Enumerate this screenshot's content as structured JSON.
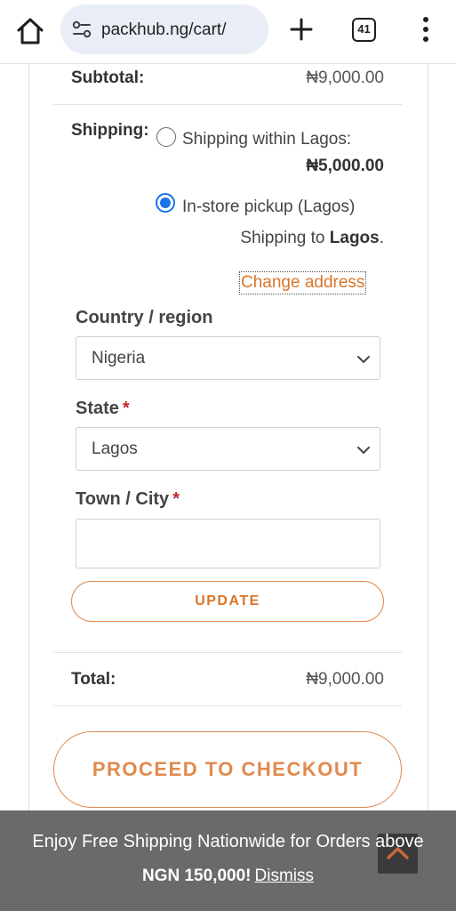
{
  "browser": {
    "url": "packhub.ng/cart/",
    "tab_count": "41"
  },
  "cart_totals": {
    "subtotal_label": "Subtotal:",
    "subtotal_value": "₦9,000.00",
    "shipping_label": "Shipping:",
    "options": [
      {
        "label": "Shipping within Lagos:",
        "price": "₦5,000.00",
        "selected": false
      },
      {
        "label": "In-store pickup (Lagos)",
        "selected": true
      }
    ],
    "shipping_to_prefix": "Shipping to",
    "shipping_to_place": "Lagos",
    "shipping_to_suffix": ".",
    "change_address": "Change address",
    "country_label": "Country / region",
    "country_value": "Nigeria",
    "state_label": "State",
    "state_value": "Lagos",
    "town_label": "Town / City",
    "town_value": "",
    "required_mark": "*",
    "update_button": "UPDATE",
    "total_label": "Total:",
    "total_value": "₦9,000.00",
    "checkout_button": "PROCEED TO CHECKOUT"
  },
  "banner": {
    "line1": "Enjoy Free Shipping Nationwide for Orders above",
    "line2": "NGN 150,000!",
    "dismiss": "Dismiss"
  },
  "colors": {
    "accent": "#e08a4d",
    "link": "#d9752a",
    "radio_selected": "#1a73e8",
    "required": "#c0272d"
  },
  "icons": [
    "home-icon",
    "site-info-icon",
    "plus-icon",
    "more-vert-icon",
    "chevron-down-icon",
    "chevron-up-icon"
  ]
}
